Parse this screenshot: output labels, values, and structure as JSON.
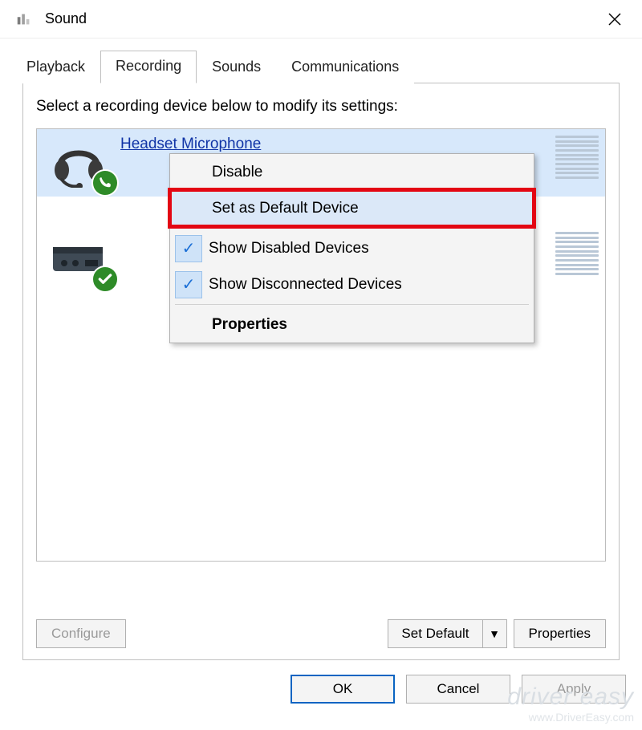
{
  "window": {
    "title": "Sound"
  },
  "tabs": [
    {
      "label": "Playback"
    },
    {
      "label": "Recording"
    },
    {
      "label": "Sounds"
    },
    {
      "label": "Communications"
    }
  ],
  "active_tab": 1,
  "instructions": "Select a recording device below to modify its settings:",
  "devices": [
    {
      "name": "Headset Microphone",
      "selected": true,
      "icon": "headset",
      "status_icon": "phone"
    },
    {
      "name": "",
      "selected": false,
      "icon": "interface-box",
      "status_icon": "check"
    }
  ],
  "context_menu": {
    "items": [
      {
        "label": "Disable",
        "checked": false,
        "bold": false,
        "highlight": false
      },
      {
        "label": "Set as Default Device",
        "checked": false,
        "bold": false,
        "highlight": true,
        "redbox": true
      },
      {
        "label": "Show Disabled Devices",
        "checked": true,
        "bold": false
      },
      {
        "label": "Show Disconnected Devices",
        "checked": true,
        "bold": false
      },
      {
        "label": "Properties",
        "checked": false,
        "bold": true
      }
    ]
  },
  "panel_buttons": {
    "configure": "Configure",
    "set_default": "Set Default",
    "properties": "Properties"
  },
  "dialog_buttons": {
    "ok": "OK",
    "cancel": "Cancel",
    "apply": "Apply"
  },
  "watermark": {
    "line1": "driver easy",
    "line2": "www.DriverEasy.com"
  }
}
